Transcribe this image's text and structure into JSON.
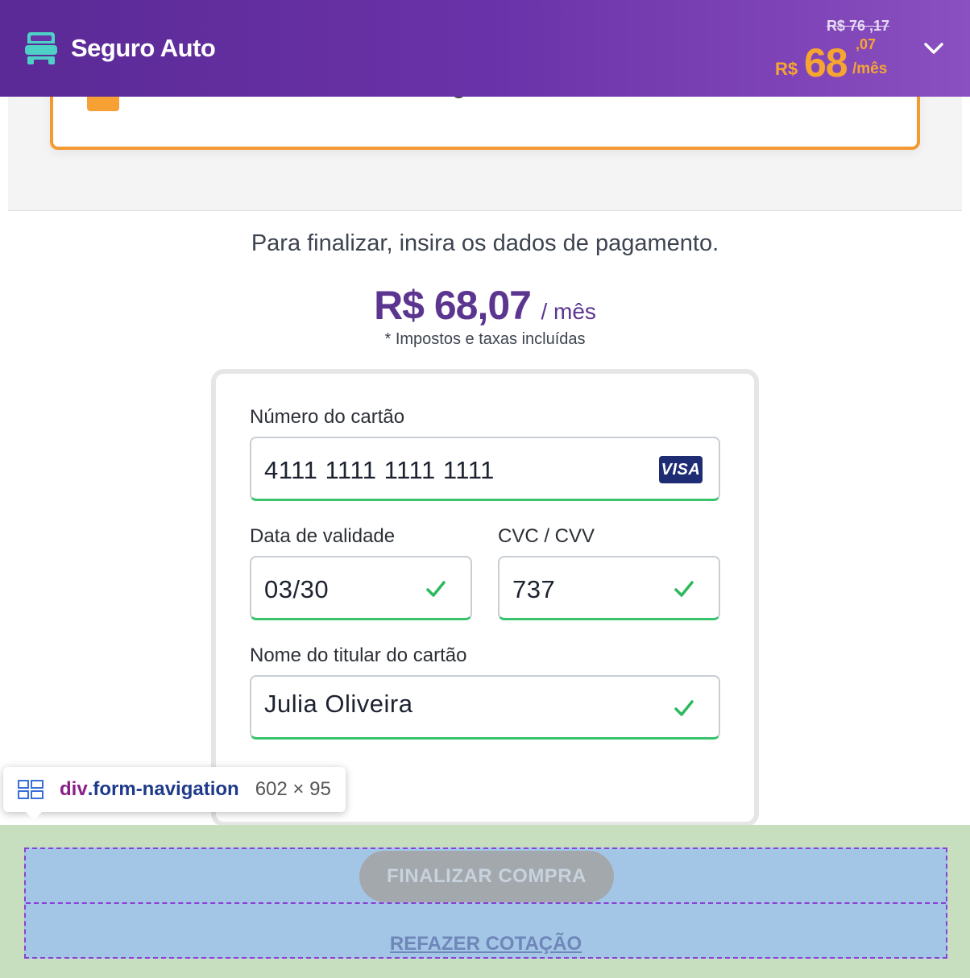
{
  "header": {
    "title": "Seguro Auto",
    "old_price": "R$ 76 ,17",
    "price_currency": "R$",
    "price_integer": "68",
    "price_cents": ",07",
    "price_period": "/mês",
    "accent_color": "#f7a531",
    "brand_icon": "car-icon",
    "toggle_icon": "chevron-down-icon"
  },
  "interest_option": {
    "label": "Não tenho interesse, obrigado"
  },
  "payment": {
    "intro": "Para finalizar, insira os dados de pagamento.",
    "price_value": "R$ 68,07",
    "price_period": "/ mês",
    "taxes_note": "* Impostos e taxas incluídas"
  },
  "form": {
    "card_number_label": "Número do cartão",
    "card_number_value": "4111 1111 1111 1111",
    "card_brand": "VISA",
    "expiry_label": "Data de validade",
    "expiry_value": "03/30",
    "cvc_label": "CVC / CVV",
    "cvc_value": "737",
    "holder_label": "Nome do titular do cartão",
    "holder_value": "Julia Oliveira"
  },
  "devtools_tooltip": {
    "tag": "div",
    "class": ".form-navigation",
    "size": "602 × 95"
  },
  "navigation": {
    "finalize_label": "FINALIZAR COMPRA",
    "redo_label": "REFAZER COTAÇÃO"
  }
}
